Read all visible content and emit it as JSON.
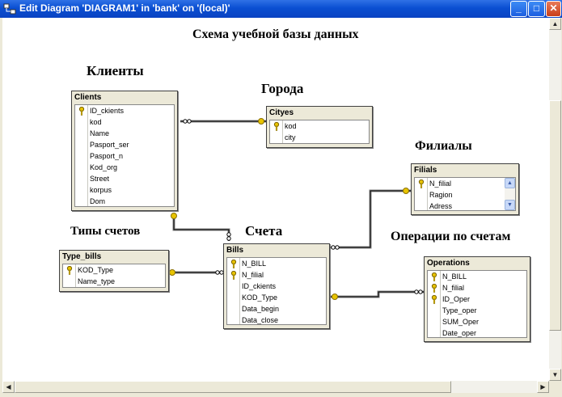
{
  "window": {
    "title": "Edit Diagram 'DIAGRAM1' in 'bank' on '(local)'",
    "controls": {
      "minimize": "_",
      "maximize": "□",
      "close": "✕"
    }
  },
  "labels": {
    "heading": "Схема учебной базы данных",
    "clients": "Клиенты",
    "cities": "Города",
    "branches": "Филиалы",
    "bill_types": "Типы счетов",
    "bills": "Счета",
    "operations": "Операции по счетам"
  },
  "tables": {
    "clients": {
      "name": "Clients",
      "fields": [
        {
          "name": "ID_ckients",
          "key": true
        },
        {
          "name": "kod"
        },
        {
          "name": "Name"
        },
        {
          "name": "Pasport_ser"
        },
        {
          "name": "Pasport_n"
        },
        {
          "name": "Kod_org"
        },
        {
          "name": "Street"
        },
        {
          "name": "korpus"
        },
        {
          "name": "Dom"
        }
      ]
    },
    "cityes": {
      "name": "Cityes",
      "fields": [
        {
          "name": "kod",
          "key": true
        },
        {
          "name": "city"
        }
      ]
    },
    "filials": {
      "name": "Filials",
      "fields": [
        {
          "name": "N_filial",
          "key": true
        },
        {
          "name": "Ragion"
        },
        {
          "name": "Adress"
        }
      ]
    },
    "type_bills": {
      "name": "Type_bills",
      "fields": [
        {
          "name": "KOD_Type",
          "key": true
        },
        {
          "name": "Name_type"
        }
      ]
    },
    "bills": {
      "name": "Bills",
      "fields": [
        {
          "name": "N_BILL",
          "key": true
        },
        {
          "name": "N_filial",
          "key": true
        },
        {
          "name": "ID_ckients"
        },
        {
          "name": "KOD_Type"
        },
        {
          "name": "Data_begin"
        },
        {
          "name": "Data_close"
        }
      ]
    },
    "operations": {
      "name": "Operations",
      "fields": [
        {
          "name": "N_BILL",
          "key": true
        },
        {
          "name": "N_filial",
          "key": true
        },
        {
          "name": "ID_Oper",
          "key": true
        },
        {
          "name": "Type_oper"
        },
        {
          "name": "SUM_Oper"
        },
        {
          "name": "Date_oper"
        }
      ]
    }
  },
  "icons": {
    "key": "key-icon",
    "app": "diagram-icon"
  },
  "colors": {
    "titlebar": "#0A4FD2",
    "canvas": "#FFFFFF",
    "table_face": "#ECE9D8",
    "key": "#E8C400"
  }
}
